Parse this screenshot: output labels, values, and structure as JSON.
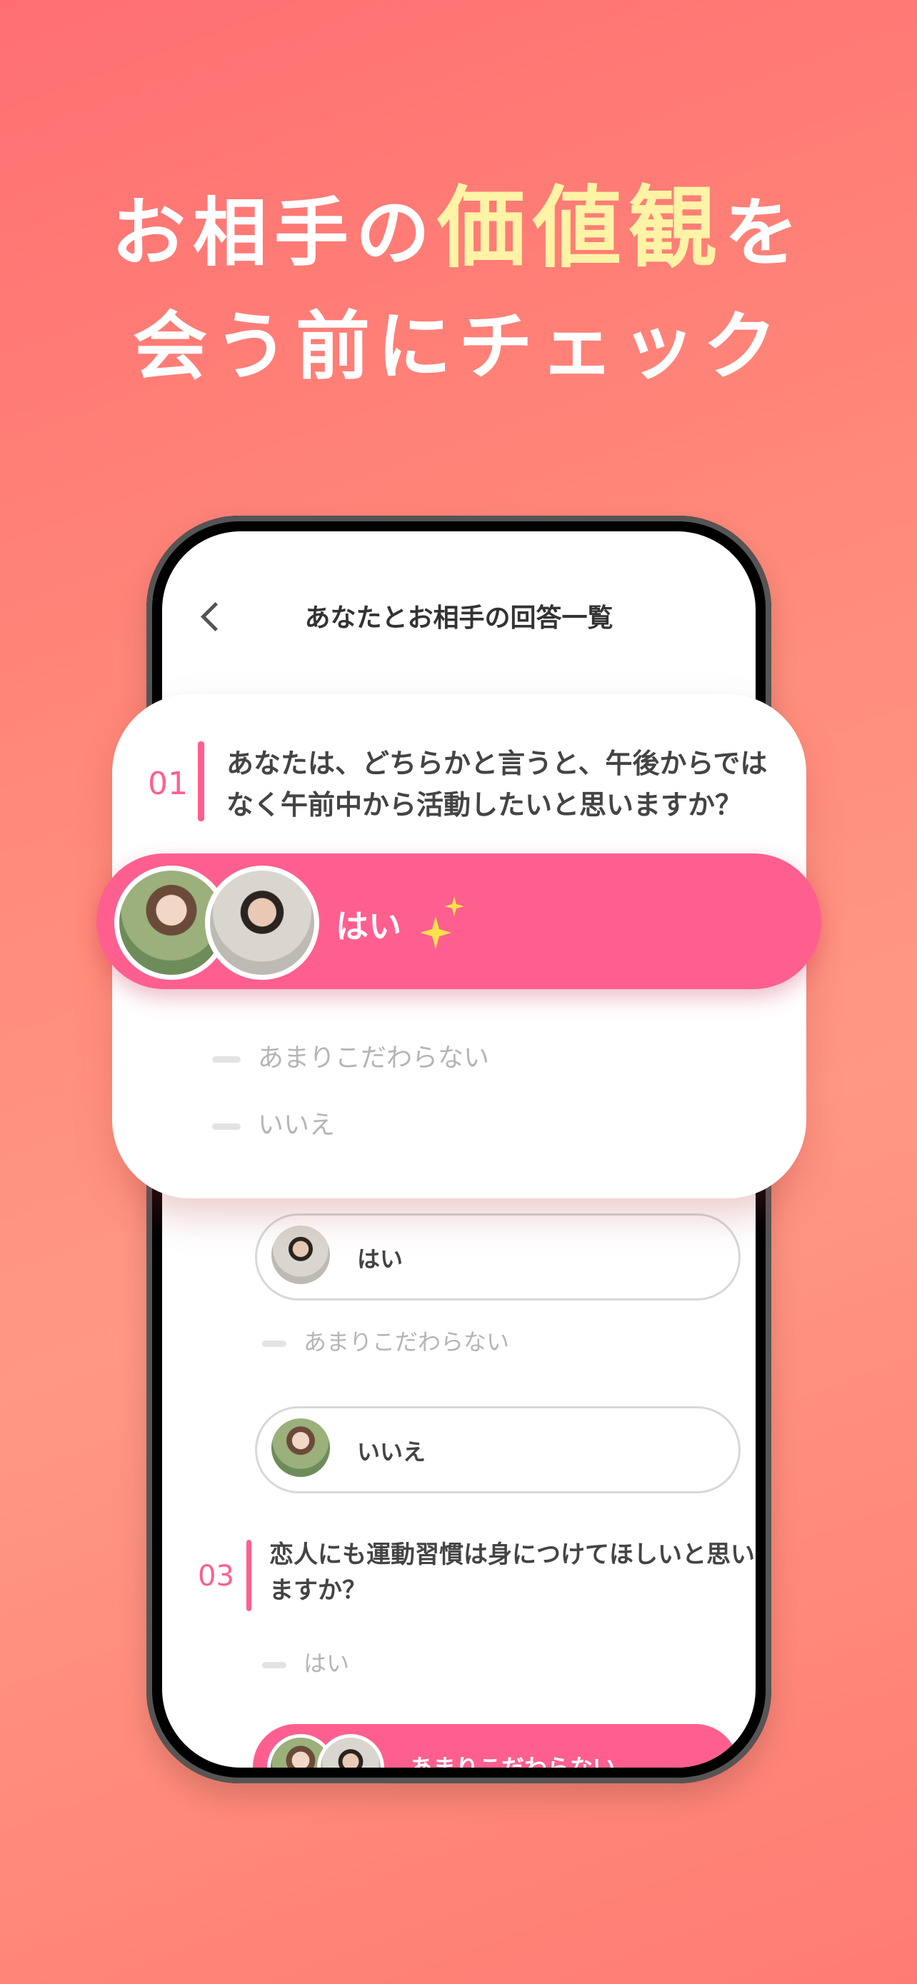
{
  "headline": {
    "line1_pre": "お相手の",
    "line1_highlight": "価値観",
    "line1_post": "を",
    "line2": "会う前にチェック"
  },
  "screen": {
    "title": "あなたとお相手の回答一覧",
    "rows": [
      {
        "label": "はい"
      },
      {
        "label": "あまりこだわらない"
      },
      {
        "label": "いいえ"
      }
    ],
    "q3": {
      "number": "03",
      "text_line1": "恋人にも運動習慣は身につけてほしいと思い",
      "text_line2": "ますか？",
      "options": [
        {
          "label": "はい"
        },
        {
          "label": "あまりこだわらない"
        }
      ]
    }
  },
  "card": {
    "number": "01",
    "text_line1": "あなたは、どちらかと言うと、午後からでは",
    "text_line2": "なく午前中から活動したいと思いますか？",
    "selected_label": "はい",
    "other_options": [
      {
        "label": "あまりこだわらない"
      },
      {
        "label": "いいえ"
      }
    ]
  },
  "colors": {
    "accent": "#ff5f8f",
    "highlight": "#fff3a6",
    "sparkle": "#ffe14d"
  },
  "icons": {
    "back": "chevron-left-icon",
    "sparkle": "sparkle-icon"
  }
}
